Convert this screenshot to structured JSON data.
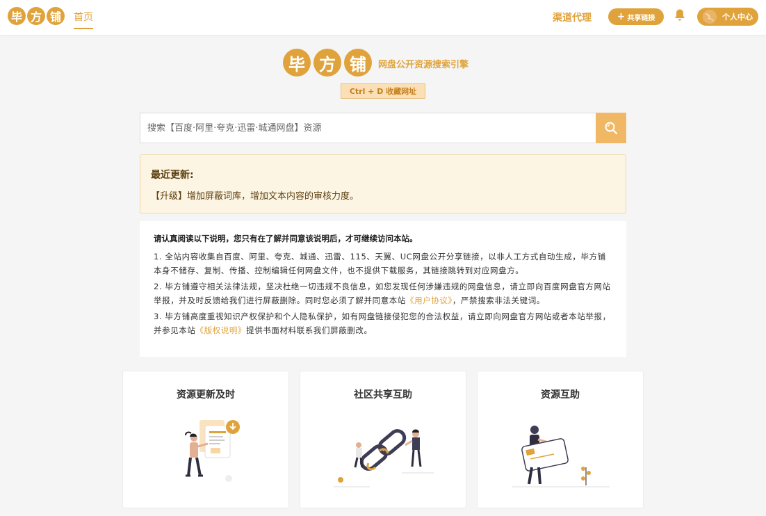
{
  "header": {
    "logo_chars": [
      "毕",
      "方",
      "铺"
    ],
    "nav_home": "首页",
    "channel_label": "渠道代理",
    "share_label": "共享链接",
    "share_icon": "plus-icon",
    "bell_icon": "bell-icon",
    "user_label": "个人中心"
  },
  "hero": {
    "logo_chars": [
      "毕",
      "方",
      "铺"
    ],
    "slogan": "网盘公开资源搜索引擎",
    "hotkey": "Ctrl + D 收藏网址"
  },
  "search": {
    "placeholder": "搜索【百度·阿里·夸克·迅雷·城通网盘】资源",
    "value": "",
    "button_icon": "search-icon"
  },
  "notice": {
    "title": "最近更新:",
    "text": "【升级】增加屏蔽词库，增加文本内容的审核力度。"
  },
  "disclaimer": {
    "heading": "请认真阅读以下说明，您只有在了解并同意该说明后，才可继续访问本站。",
    "p1": "1. 全站内容收集自百度、阿里、夸克、城通、迅雷、115、天翼、UC网盘公开分享链接，以非人工方式自动生成，毕方铺本身不储存、复制、传播、控制编辑任何网盘文件，也不提供下载服务，其链接跳转到对应网盘方。",
    "p2_before": "2. 毕方铺遵守相关法律法规，坚决杜绝一切违规不良信息，如您发现任何涉嫌违规的网盘信息，请立即向百度网盘官方网站举报，并及时反馈给我们进行屏蔽删除。同时您必须了解并同意本站",
    "p2_link": "《用户协议》",
    "p2_after": "，严禁搜索非法关键词。",
    "p3_before": "3. 毕方铺高度重视知识产权保护和个人隐私保护，如有网盘链接侵犯您的合法权益，请立即向网盘官方网站或者本站举报，并参见本站",
    "p3_link": "《版权说明》",
    "p3_after": "提供书面材料联系我们屏蔽删改。"
  },
  "cards": [
    {
      "title": "资源更新及时"
    },
    {
      "title": "社区共享互助"
    },
    {
      "title": "资源互助"
    }
  ],
  "colors": {
    "brand": "#e0a33c",
    "notice_bg": "#fdf5e3",
    "search_button": "#f0b865",
    "page_bg": "#f5f5f5"
  }
}
